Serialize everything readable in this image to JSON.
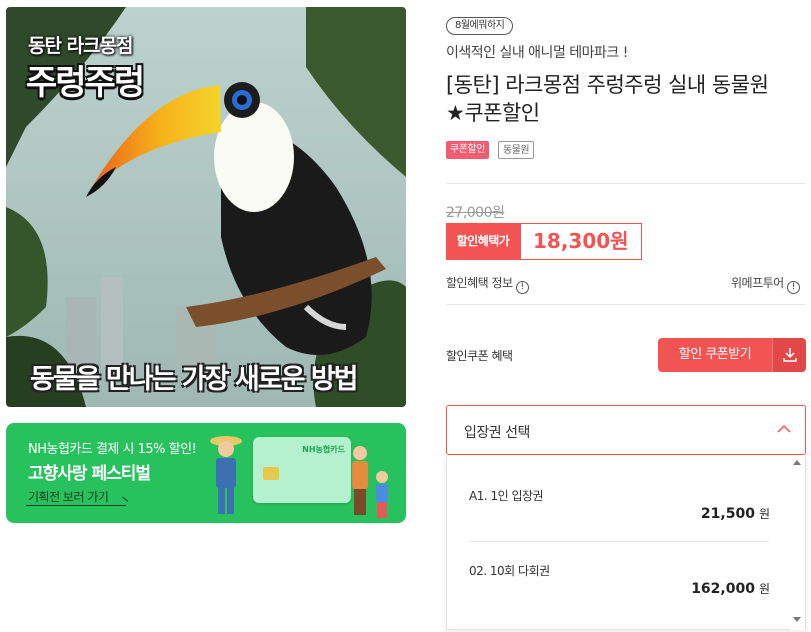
{
  "hero": {
    "subtitle": "동탄 라크몽점",
    "title": "주렁주렁",
    "caption": "동물을 만나는 가장 새로운 방법"
  },
  "banner": {
    "line1": "NH농협카드 결제 시 15% 할인!",
    "line2": "고향사랑 페스티벌",
    "link": "기획전 보러 가기",
    "card_brand": "NH농협카드",
    "bg_color": "#27c15d"
  },
  "product": {
    "tag": "8월에뭐하지",
    "subtitle": "이색적인 실내 애니멀 테마파크 !",
    "title": "[동탄] 라크몽점 주렁주렁 실내 동물원 ★쿠폰할인",
    "badges": [
      "쿠폰할인",
      "동물원"
    ],
    "original_price": "27,000원",
    "discount_label": "할인혜택가",
    "sale_price": "18,300원",
    "info_left": "할인혜택 정보",
    "info_right": "위메프투어",
    "accent_color": "#f25353"
  },
  "coupon": {
    "label": "할인쿠폰 혜택",
    "button": "할인 쿠폰받기",
    "icon": "download-icon"
  },
  "ticket_select": {
    "placeholder": "입장권 선택",
    "options": [
      {
        "name": "A1. 1인 입장권",
        "price": "21,500",
        "unit": "원"
      },
      {
        "name": "02. 10회 다회권",
        "price": "162,000",
        "unit": "원"
      }
    ]
  }
}
